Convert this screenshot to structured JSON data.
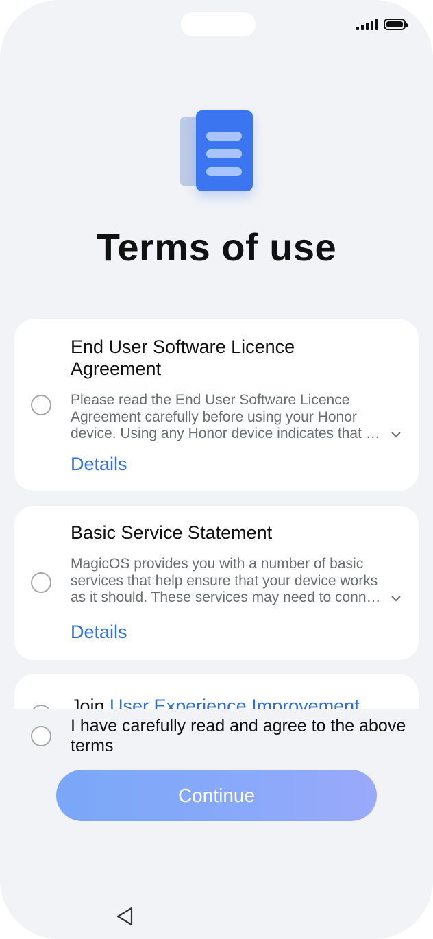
{
  "status_bar": {
    "signal_icon": "signal-icon",
    "battery_icon": "battery-icon"
  },
  "header": {
    "icon": "document-icon",
    "title": "Terms of use"
  },
  "cards": [
    {
      "title": "End User Software Licence Agreement",
      "description": "Please read the End User Software Licence Agreement carefully before using your Honor device. Using any Honor device indicates that …",
      "details_label": "Details"
    },
    {
      "title": "Basic Service Statement",
      "description": "MagicOS provides you with a number of basic services that help ensure that your device works as it should. These services may need to conn…",
      "details_label": "Details"
    },
    {
      "title_prefix": "Join ",
      "title_link": "User Experience Improvement"
    }
  ],
  "agreement": {
    "label": "I have carefully read and agree to the above terms"
  },
  "continue_button": {
    "label": "Continue"
  },
  "nav": {
    "back_icon": "back-triangle-icon"
  },
  "colors": {
    "accent": "#2f6fe0",
    "background": "#f1f3f7",
    "button": "#8aa9fa"
  }
}
